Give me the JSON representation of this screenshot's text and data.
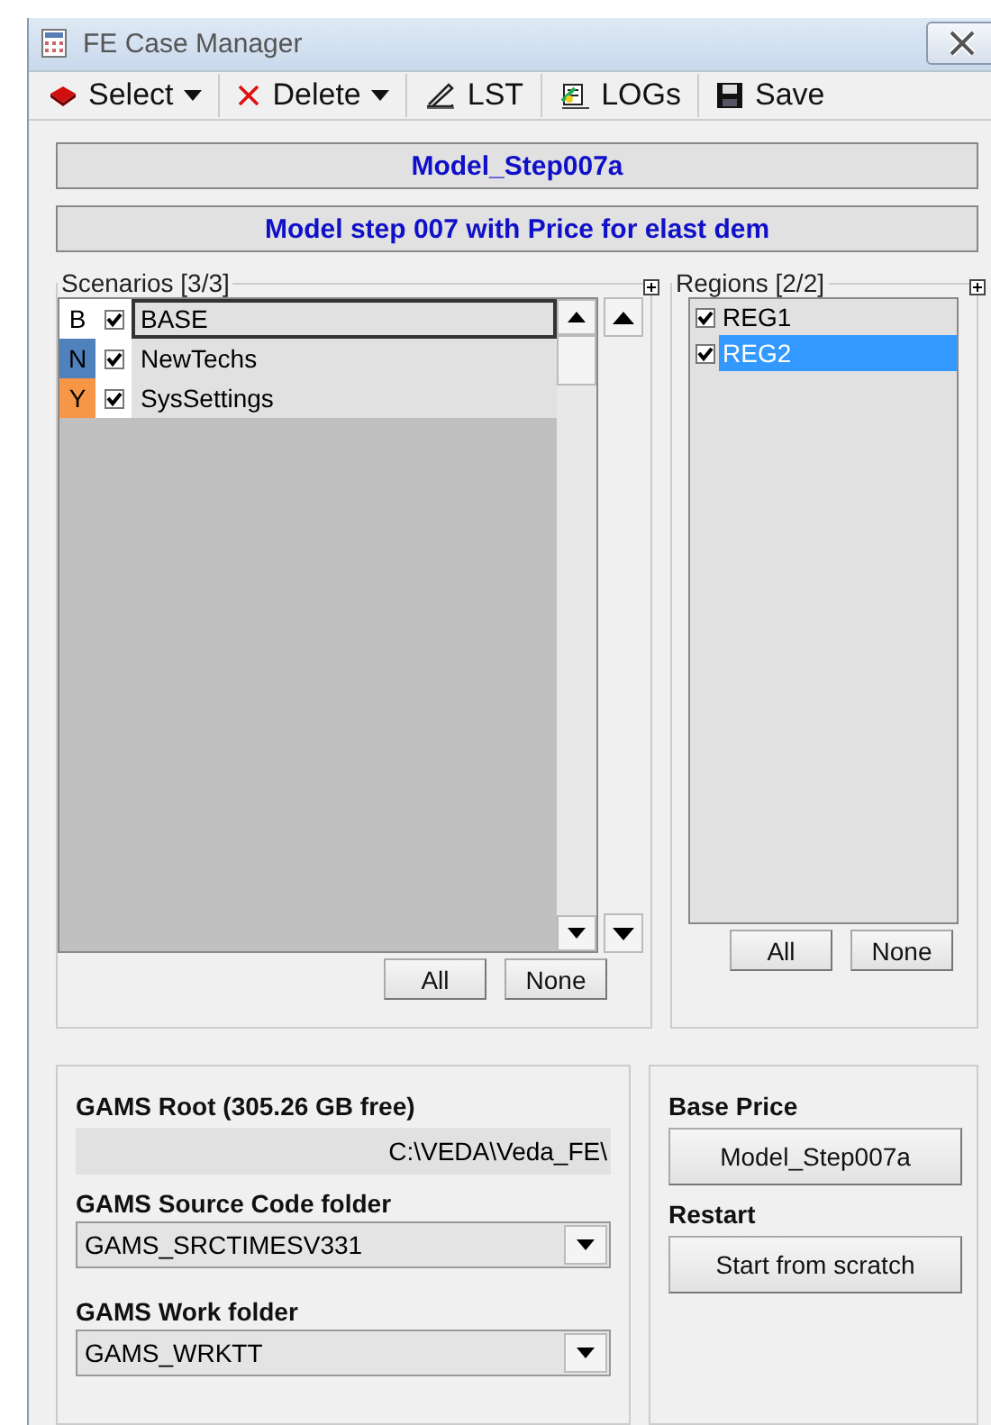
{
  "window": {
    "title": "FE Case Manager"
  },
  "toolbar": [
    {
      "label": "Select",
      "kind": "book",
      "dropdown": true
    },
    {
      "label": "Delete",
      "kind": "cross",
      "dropdown": true
    },
    {
      "label": "LST",
      "kind": "pen",
      "dropdown": false
    },
    {
      "label": "LOGs",
      "kind": "logs",
      "dropdown": false
    },
    {
      "label": "Save",
      "kind": "disk",
      "dropdown": false
    }
  ],
  "case_name": "Model_Step007a",
  "case_description": "Model step 007 with Price for elast dem",
  "scenarios": {
    "title": "Scenarios [3/3]",
    "items": [
      {
        "letter": "B",
        "color": "#ffffff",
        "checked": true,
        "name": "BASE",
        "selected": true
      },
      {
        "letter": "N",
        "color": "#4f81bd",
        "checked": true,
        "name": "NewTechs",
        "selected": false
      },
      {
        "letter": "Y",
        "color": "#f79646",
        "checked": true,
        "name": "SysSettings",
        "selected": false
      }
    ],
    "buttons": [
      "All",
      "None"
    ]
  },
  "regions": {
    "title": "Regions [2/2]",
    "items": [
      {
        "checked": true,
        "name": "REG1",
        "selected": false
      },
      {
        "checked": true,
        "name": "REG2",
        "selected": true
      }
    ],
    "buttons": [
      "All",
      "None"
    ]
  },
  "gams": {
    "root_label": "GAMS Root (305.26 GB free)",
    "root_value": "C:\\VEDA\\Veda_FE\\",
    "source_label": "GAMS Source Code folder",
    "source_value": "GAMS_SRCTIMESV331",
    "work_label": "GAMS Work folder",
    "work_value": "GAMS_WRKTT"
  },
  "run": {
    "base_price_label": "Base Price",
    "base_price_button": "Model_Step007a",
    "restart_label": "Restart",
    "restart_button": "Start from scratch"
  }
}
